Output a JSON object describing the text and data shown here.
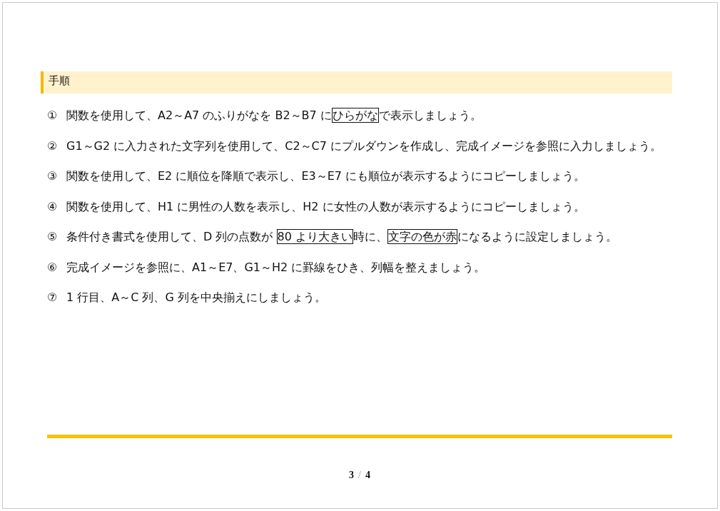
{
  "section": {
    "title": "手順"
  },
  "steps": [
    {
      "marker": "①",
      "parts": [
        {
          "text": "関数を使用して、A2～A7 のふりがなを B2～B7 に",
          "boxed": false
        },
        {
          "text": "ひらがな",
          "boxed": true
        },
        {
          "text": "で表示しましょう。",
          "boxed": false
        }
      ]
    },
    {
      "marker": "②",
      "parts": [
        {
          "text": "G1～G2 に入力された文字列を使用して、C2～C7 にプルダウンを作成し、完成イメージを参照に入力しましょう。",
          "boxed": false
        }
      ]
    },
    {
      "marker": "③",
      "parts": [
        {
          "text": "関数を使用して、E2 に順位を降順で表示し、E3～E7 にも順位が表示するようにコピーしましょう。",
          "boxed": false
        }
      ]
    },
    {
      "marker": "④",
      "parts": [
        {
          "text": "関数を使用して、H1 に男性の人数を表示し、H2 に女性の人数が表示するようにコピーしましょう。",
          "boxed": false
        }
      ]
    },
    {
      "marker": "⑤",
      "parts": [
        {
          "text": "条件付き書式を使用して、D 列の点数が ",
          "boxed": false
        },
        {
          "text": "80 より大きい",
          "boxed": true
        },
        {
          "text": "時に、",
          "boxed": false
        },
        {
          "text": "文字の色が赤",
          "boxed": true
        },
        {
          "text": "になるように設定しましょう。",
          "boxed": false
        }
      ]
    },
    {
      "marker": "⑥",
      "parts": [
        {
          "text": "完成イメージを参照に、A1～E7、G1～H2 に罫線をひき、列幅を整えましょう。",
          "boxed": false
        }
      ]
    },
    {
      "marker": "⑦",
      "parts": [
        {
          "text": "1 行目、A～C 列、G 列を中央揃えにしましょう。",
          "boxed": false
        }
      ]
    }
  ],
  "footer": {
    "page": "3",
    "separator": "/",
    "total": "4"
  }
}
